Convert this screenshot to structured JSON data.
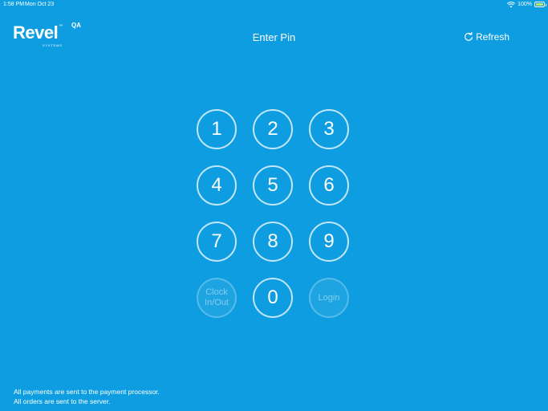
{
  "status_bar": {
    "time": "1:58 PM",
    "date": "Mon Oct 23",
    "battery": "100%",
    "icons": [
      "wifi-icon",
      "battery-icon"
    ]
  },
  "header": {
    "logo_text": "Revel",
    "logo_tm": "™",
    "logo_sub": "SYSTEMS",
    "logo_badge": "QA",
    "title": "Enter Pin",
    "refresh_label": "Refresh",
    "refresh_icon": "refresh-icon"
  },
  "keypad": {
    "keys": [
      "1",
      "2",
      "3",
      "4",
      "5",
      "6",
      "7",
      "8",
      "9"
    ],
    "clock_line1": "Clock",
    "clock_line2": "In/Out",
    "zero": "0",
    "login": "Login"
  },
  "footer": {
    "line1": "All payments are sent to the payment processor.",
    "line2": "All orders are sent to the server."
  },
  "colors": {
    "background": "#0d9de0",
    "text": "#ffffff",
    "battery_fill": "#c3e86a"
  }
}
